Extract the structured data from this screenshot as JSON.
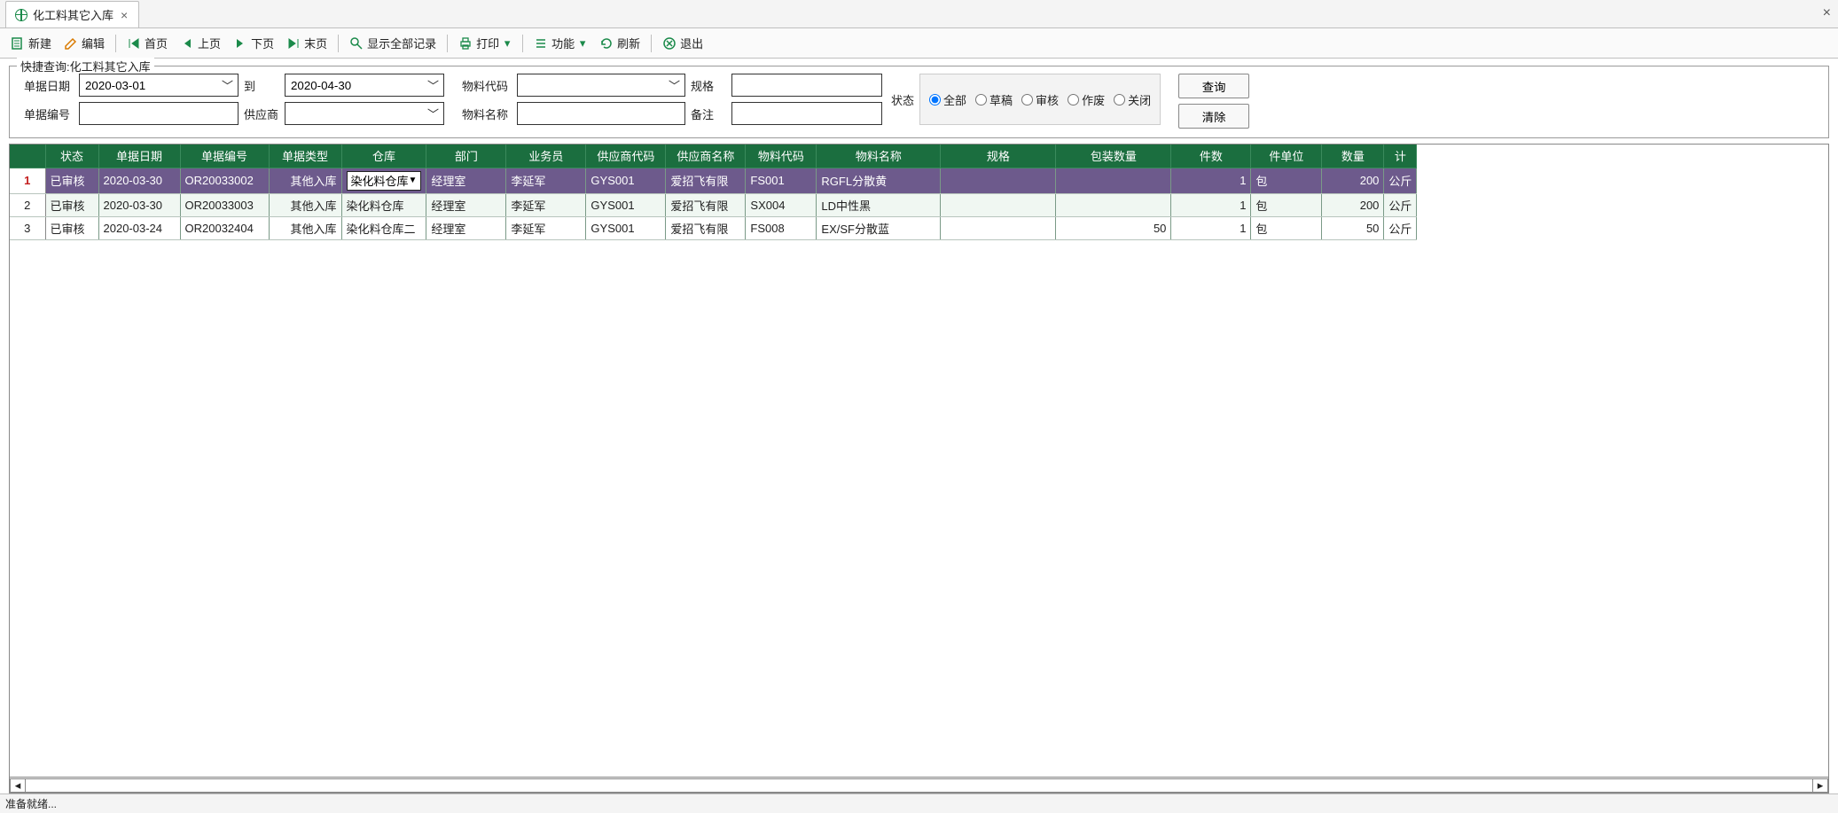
{
  "tab": {
    "title": "化工料其它入库"
  },
  "toolbar": {
    "new": "新建",
    "edit": "编辑",
    "first": "首页",
    "prev": "上页",
    "next": "下页",
    "last": "末页",
    "showAll": "显示全部记录",
    "print": "打印",
    "func": "功能",
    "refresh": "刷新",
    "exit": "退出"
  },
  "query": {
    "legend": "快捷查询:化工料其它入库",
    "labels": {
      "docDate": "单据日期",
      "to": "到",
      "matCode": "物料代码",
      "spec": "规格",
      "docNo": "单据编号",
      "supplier": "供应商",
      "matName": "物料名称",
      "remark": "备注",
      "status": "状态"
    },
    "values": {
      "dateFrom": "2020-03-01",
      "dateTo": "2020-04-30",
      "matCode": "",
      "spec": "",
      "docNo": "",
      "supplier": "",
      "matName": "",
      "remark": ""
    },
    "statusOptions": {
      "all": "全部",
      "draft": "草稿",
      "audit": "审核",
      "void": "作废",
      "close": "关闭"
    },
    "buttons": {
      "search": "查询",
      "clear": "清除"
    }
  },
  "grid": {
    "headers": [
      "",
      "状态",
      "单据日期",
      "单据编号",
      "单据类型",
      "仓库",
      "部门",
      "业务员",
      "供应商代码",
      "供应商名称",
      "物料代码",
      "物料名称",
      "规格",
      "包装数量",
      "件数",
      "件单位",
      "数量",
      "计"
    ],
    "rows": [
      {
        "n": "1",
        "status": "已审核",
        "date": "2020-03-30",
        "no": "OR20033002",
        "type": "其他入库",
        "wh": "染化料仓库",
        "dept": "经理室",
        "biz": "李延军",
        "supCode": "GYS001",
        "supName": "爱招飞有限",
        "matCode": "FS001",
        "matName": "RGFL分散黄",
        "spec": "",
        "pack": "",
        "pcs": "1",
        "unit": "包",
        "qty": "200",
        "ext": "公斤"
      },
      {
        "n": "2",
        "status": "已审核",
        "date": "2020-03-30",
        "no": "OR20033003",
        "type": "其他入库",
        "wh": "染化料仓库",
        "dept": "经理室",
        "biz": "李延军",
        "supCode": "GYS001",
        "supName": "爱招飞有限",
        "matCode": "SX004",
        "matName": "LD中性黑",
        "spec": "",
        "pack": "",
        "pcs": "1",
        "unit": "包",
        "qty": "200",
        "ext": "公斤"
      },
      {
        "n": "3",
        "status": "已审核",
        "date": "2020-03-24",
        "no": "OR20032404",
        "type": "其他入库",
        "wh": "染化料仓库二",
        "dept": "经理室",
        "biz": "李延军",
        "supCode": "GYS001",
        "supName": "爱招飞有限",
        "matCode": "FS008",
        "matName": "EX/SF分散蓝",
        "spec": "",
        "pack": "50",
        "pcs": "1",
        "unit": "包",
        "qty": "50",
        "ext": "公斤"
      }
    ]
  },
  "statusBar": "准备就绪..."
}
